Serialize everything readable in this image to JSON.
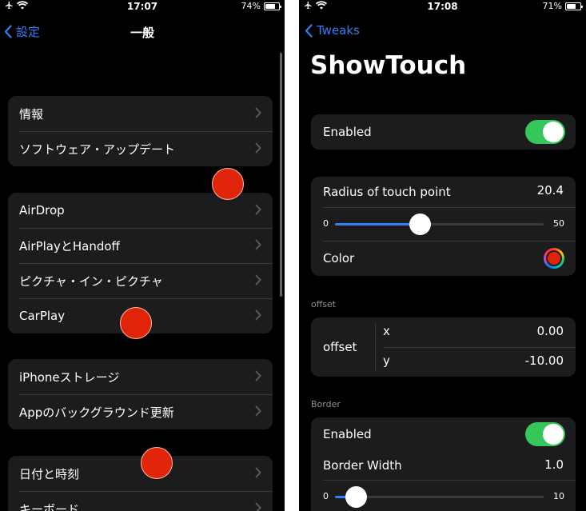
{
  "left_screen": {
    "status": {
      "time": "17:07",
      "battery": "74%",
      "battery_level": 0.74
    },
    "nav": {
      "back_label": "設定",
      "title": "一般"
    },
    "groups": [
      {
        "items": [
          "情報",
          "ソフトウェア・アップデート"
        ]
      },
      {
        "items": [
          "AirDrop",
          "AirPlayとHandoff",
          "ピクチャ・イン・ピクチャ",
          "CarPlay"
        ]
      },
      {
        "items": [
          "iPhoneストレージ",
          "Appのバックグラウンド更新"
        ]
      },
      {
        "items": [
          "日付と時刻",
          "キーボード"
        ]
      }
    ]
  },
  "right_screen": {
    "status": {
      "time": "17:08",
      "battery": "71%",
      "battery_level": 0.71
    },
    "nav": {
      "back_label": "Tweaks"
    },
    "title": "ShowTouch",
    "enabled_label": "Enabled",
    "enabled_on": true,
    "radius": {
      "label": "Radius of touch point",
      "value": "20.4",
      "min": "0",
      "max": "50",
      "level": 20.4
    },
    "color": {
      "label": "Color",
      "value": "#e0240a"
    },
    "offset_header": "offset",
    "offset": {
      "label": "offset",
      "x_label": "x",
      "x_value": "0.00",
      "y_label": "y",
      "y_value": "-10.00"
    },
    "border_header": "Border",
    "border": {
      "enabled_label": "Enabled",
      "enabled_on": true,
      "width_label": "Border Width",
      "width_value": "1.0",
      "min": "0",
      "max": "10",
      "level": 1.0
    }
  },
  "colors": {
    "accent": "#2f7ff5",
    "toggle_on": "#35c759",
    "touch_point": "#e0240a",
    "cell_background": "#1c1c1e"
  }
}
